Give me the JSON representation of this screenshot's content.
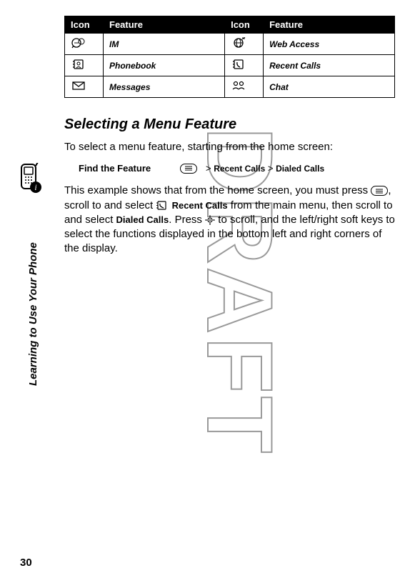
{
  "table": {
    "headers": [
      "Icon",
      "Feature",
      "Icon",
      "Feature"
    ],
    "rows": [
      {
        "f1": "IM",
        "f2": "Web Access"
      },
      {
        "f1": "Phonebook",
        "f2": "Recent Calls"
      },
      {
        "f1": "Messages",
        "f2": "Chat"
      }
    ]
  },
  "section_title": "Selecting a Menu Feature",
  "intro": "To select a menu feature, starting from the home screen:",
  "find_label": "Find the Feature",
  "crumb1": "Recent Calls",
  "crumb2": "Dialed Calls",
  "gt": ">",
  "para_parts": {
    "p1a": "This example shows that from the home screen, you must press ",
    "p1b": ", scroll to and select ",
    "p1c": " ",
    "recent": "Recent Calls",
    "p1d": " from the main menu, then scroll to and select ",
    "dialed": "Dialed Calls",
    "p1e": ". Press ",
    "p1f": " to scroll, and the left/right soft keys to select the functions displayed in the bottom left and right corners of the display."
  },
  "side_label": "Learning to Use Your Phone",
  "page_number": "30",
  "watermark_text": "DRAFT"
}
